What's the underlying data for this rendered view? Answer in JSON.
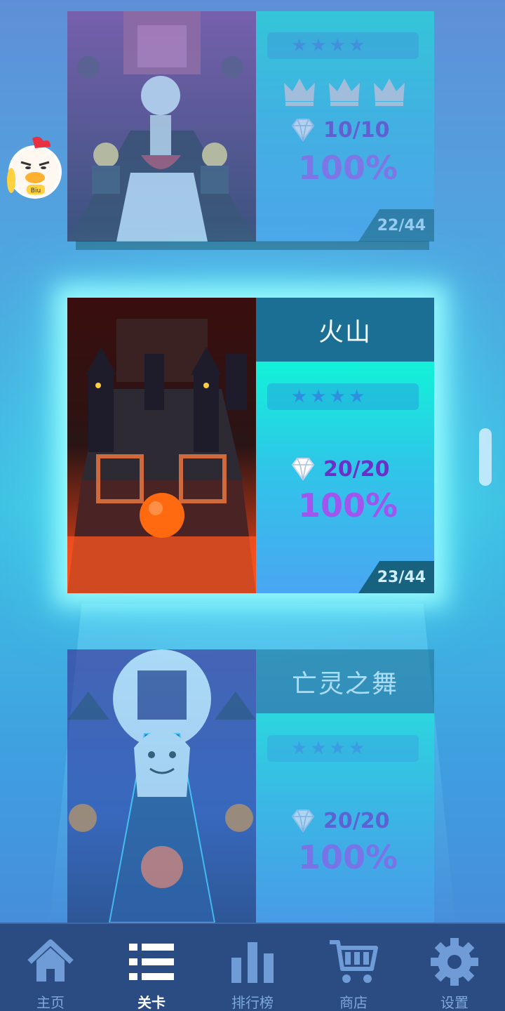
{
  "cards": [
    {
      "title": "",
      "crowns": 3,
      "gems": "10/10",
      "percent": "100%",
      "level": "22/44",
      "stars": 4
    },
    {
      "title": "火山",
      "gems": "20/20",
      "percent": "100%",
      "level": "23/44",
      "stars": 4
    },
    {
      "title": "亡灵之舞",
      "gems": "20/20",
      "percent": "100%",
      "stars": 4
    }
  ],
  "tabs": [
    {
      "label": "主页",
      "icon": "home-icon"
    },
    {
      "label": "关卡",
      "icon": "list-icon"
    },
    {
      "label": "排行榜",
      "icon": "bar-chart-icon"
    },
    {
      "label": "商店",
      "icon": "cart-icon"
    },
    {
      "label": "设置",
      "icon": "gear-icon"
    }
  ],
  "active_tab": "关卡",
  "colors": {
    "tabbar": "#2a4c83",
    "title_bar": "#1b6f94",
    "gem_text": "#6a30c8",
    "percent_text": "#a055ee"
  }
}
